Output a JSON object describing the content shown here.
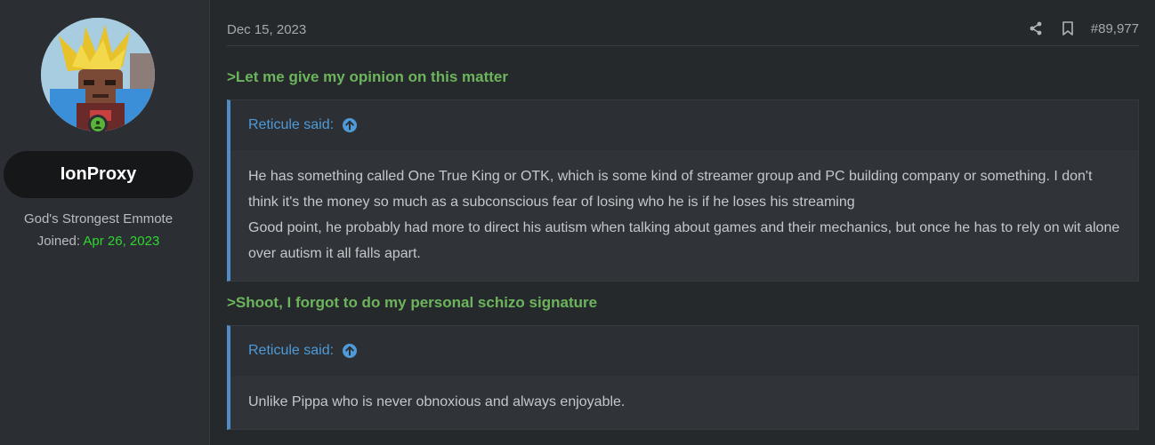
{
  "user": {
    "name": "IonProxy",
    "title": "God's Strongest Emmote",
    "joined_label": "Joined:",
    "joined_date": "Apr 26, 2023"
  },
  "post": {
    "date": "Dec 15, 2023",
    "number": "#89,977",
    "icons": [
      "share-icon",
      "bookmark-icon"
    ]
  },
  "content": {
    "greentext_1": ">Let me give my opinion on this matter",
    "quote_1": {
      "attribution": "Reticule said:",
      "line_1": "He has something called One True King or OTK, which is some kind of streamer group and PC building company or something. I don't think it's the money so much as a subconscious fear of losing who he is if he loses his streaming",
      "line_2": "Good point, he probably had more to direct his autism when talking about games and their mechanics, but once he has to rely on wit alone over autism it all falls apart."
    },
    "greentext_2": ">Shoot, I forgot to do my personal schizo signature",
    "quote_2": {
      "attribution": "Reticule said:",
      "line_1": "Unlike Pippa who is never obnoxious and always enjoyable."
    }
  },
  "colors": {
    "greentext": "#6cb55c",
    "quote_accent": "#4f8dc4",
    "joined_date": "#2fd62f",
    "online": "#5ab43c"
  }
}
